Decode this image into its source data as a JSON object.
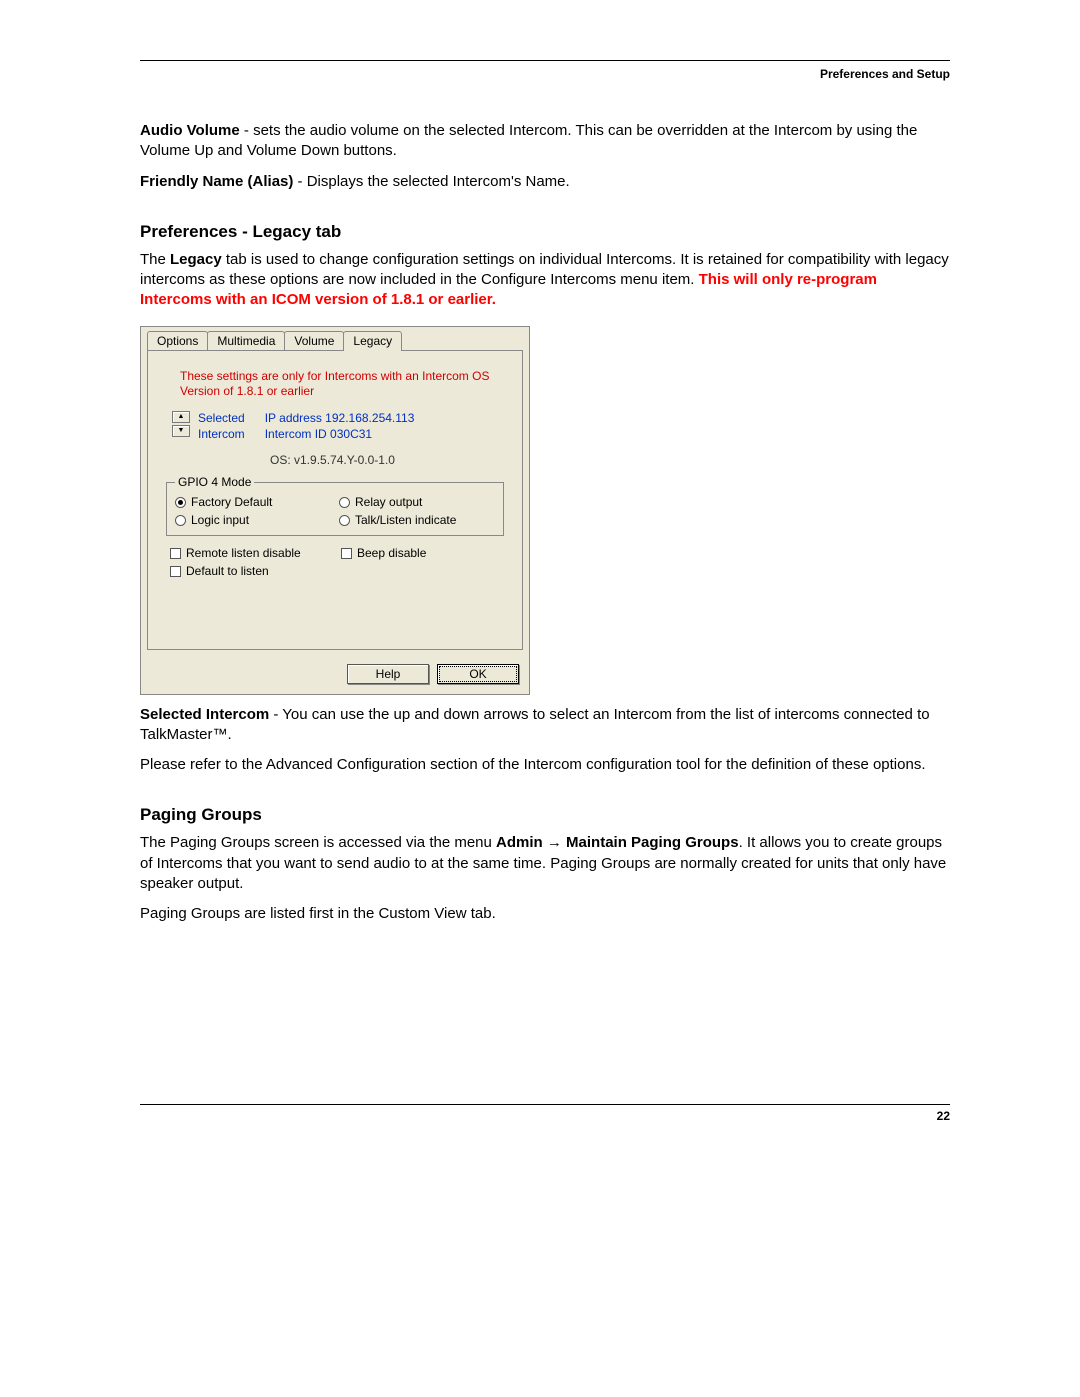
{
  "header": {
    "title": "Preferences and Setup"
  },
  "section_audio": {
    "label": "Audio Volume",
    "text": " - sets the audio volume on the selected Intercom.  This can be overridden at the Intercom by using the Volume Up and Volume Down buttons."
  },
  "section_friendly": {
    "label": "Friendly Name (Alias)",
    "text": " - Displays the selected Intercom's Name."
  },
  "heading_legacy": "Preferences - Legacy  tab",
  "legacy_intro_1a": "The ",
  "legacy_intro_1b": "Legacy",
  "legacy_intro_1c": " tab is used to change configuration settings on individual Intercoms.  It is retained for compatibility with legacy intercoms as these options are now included in the Configure Intercoms menu item.  ",
  "legacy_warning_red": "This will only re-program Intercoms with an ICOM version of 1.8.1 or earlier.",
  "dialog": {
    "tabs": [
      "Options",
      "Multimedia",
      "Volume",
      "Legacy"
    ],
    "active_tab_index": 3,
    "warning": "These settings are only for Intercoms with an Intercom OS Version of 1.8.1 or earlier",
    "selected_label_1": "Selected",
    "selected_label_2": "Intercom",
    "ip_label": "IP address 192.168.254.113",
    "id_label": "Intercom ID 030C31",
    "os_label": "OS:  v1.9.5.74.Y-0.0-1.0",
    "gpio_legend": "GPIO 4 Mode",
    "gpio_options": [
      {
        "label": "Factory Default",
        "checked": true
      },
      {
        "label": "Relay output",
        "checked": false
      },
      {
        "label": "Logic input",
        "checked": false
      },
      {
        "label": "Talk/Listen indicate",
        "checked": false
      }
    ],
    "checks": [
      {
        "label": "Remote listen disable",
        "checked": false
      },
      {
        "label": "Beep disable",
        "checked": false
      },
      {
        "label": "Default to listen",
        "checked": false
      }
    ],
    "buttons": {
      "help": "Help",
      "ok": "OK"
    }
  },
  "post_dialog": {
    "selected_label": "Selected Intercom",
    "selected_text": " - You can use the up and down arrows to select an Intercom from the list of intercoms connected to TalkMaster™.",
    "advanced_text": "Please refer to the Advanced Configuration section of the Intercom configuration tool for the definition of these options."
  },
  "heading_paging": "Paging Groups",
  "paging_1a": "The Paging Groups screen is accessed via the menu ",
  "paging_1b": "Admin ",
  "paging_arrow": "→",
  "paging_1c": " Maintain Paging Groups",
  "paging_1d": ". It allows you to create groups of Intercoms that you want to send audio to at the same time. Paging Groups are normally created for units that only have speaker output.",
  "paging_2": "Paging Groups are listed first in the Custom View tab.",
  "page_number": "22"
}
